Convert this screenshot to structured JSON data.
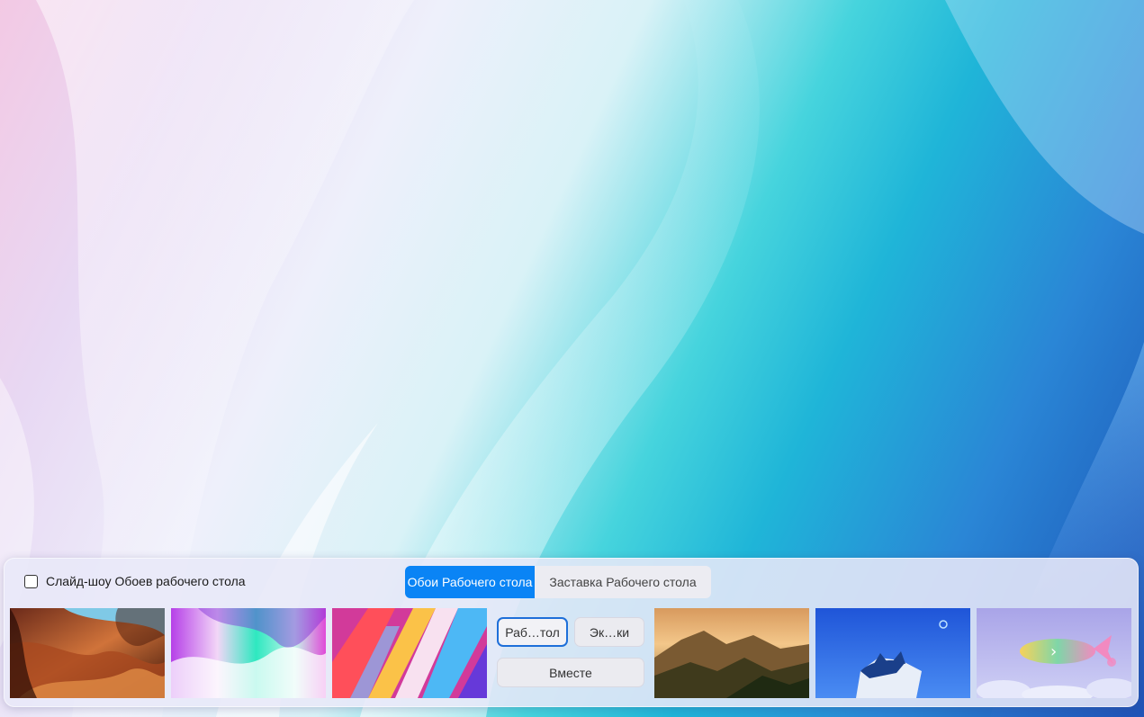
{
  "panel": {
    "slideshow_label": "Слайд-шоу Обоев рабочего стола",
    "tabs": [
      {
        "label": "Обои Рабочего стола",
        "active": true
      },
      {
        "label": "Заставка Рабочего стола",
        "active": false
      }
    ],
    "actions": {
      "desktop_label": "Раб…тол",
      "lockscreen_label": "Эк…ки",
      "both_label": "Вместе"
    },
    "next_icon": "chevron-right-icon"
  },
  "colors": {
    "accent": "#0a84f5",
    "focus_border": "#1e6fd9"
  }
}
